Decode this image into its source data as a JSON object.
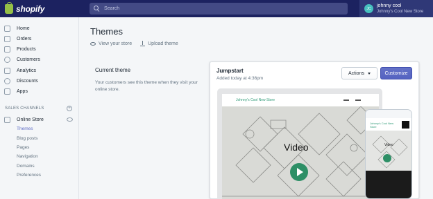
{
  "brand": {
    "name": "shopify"
  },
  "search": {
    "placeholder": "Search"
  },
  "user": {
    "initials": "JC",
    "name": "johnny cool",
    "store": "Johnny's Cool New Store"
  },
  "sidebar": {
    "items": [
      {
        "label": "Home",
        "icon": "home-icon"
      },
      {
        "label": "Orders",
        "icon": "orders-icon"
      },
      {
        "label": "Products",
        "icon": "products-icon"
      },
      {
        "label": "Customers",
        "icon": "customers-icon"
      },
      {
        "label": "Analytics",
        "icon": "analytics-icon"
      },
      {
        "label": "Discounts",
        "icon": "discounts-icon"
      },
      {
        "label": "Apps",
        "icon": "apps-icon"
      }
    ],
    "channels_heading": "SALES CHANNELS",
    "channel": {
      "label": "Online Store"
    },
    "subitems": [
      "Themes",
      "Blog posts",
      "Pages",
      "Navigation",
      "Domains",
      "Preferences"
    ]
  },
  "page": {
    "title": "Themes",
    "view_store": "View your store",
    "upload_theme": "Upload theme"
  },
  "current_theme": {
    "heading": "Current theme",
    "description": "Your customers see this theme when they visit your online store.",
    "name": "Jumpstart",
    "added": "Added today at 4:36pm",
    "actions_label": "Actions",
    "customize_label": "Customize"
  },
  "preview": {
    "store_name": "Johnny's Cool New Store",
    "video_label": "Video",
    "phone_store_name": "Johnny's Cool New Store",
    "phone_video_label": "Video"
  },
  "colors": {
    "topbar": "#1c2260",
    "accent": "#5c6ac4",
    "brand_green": "#95bf47",
    "play_green": "#2d8f66"
  }
}
